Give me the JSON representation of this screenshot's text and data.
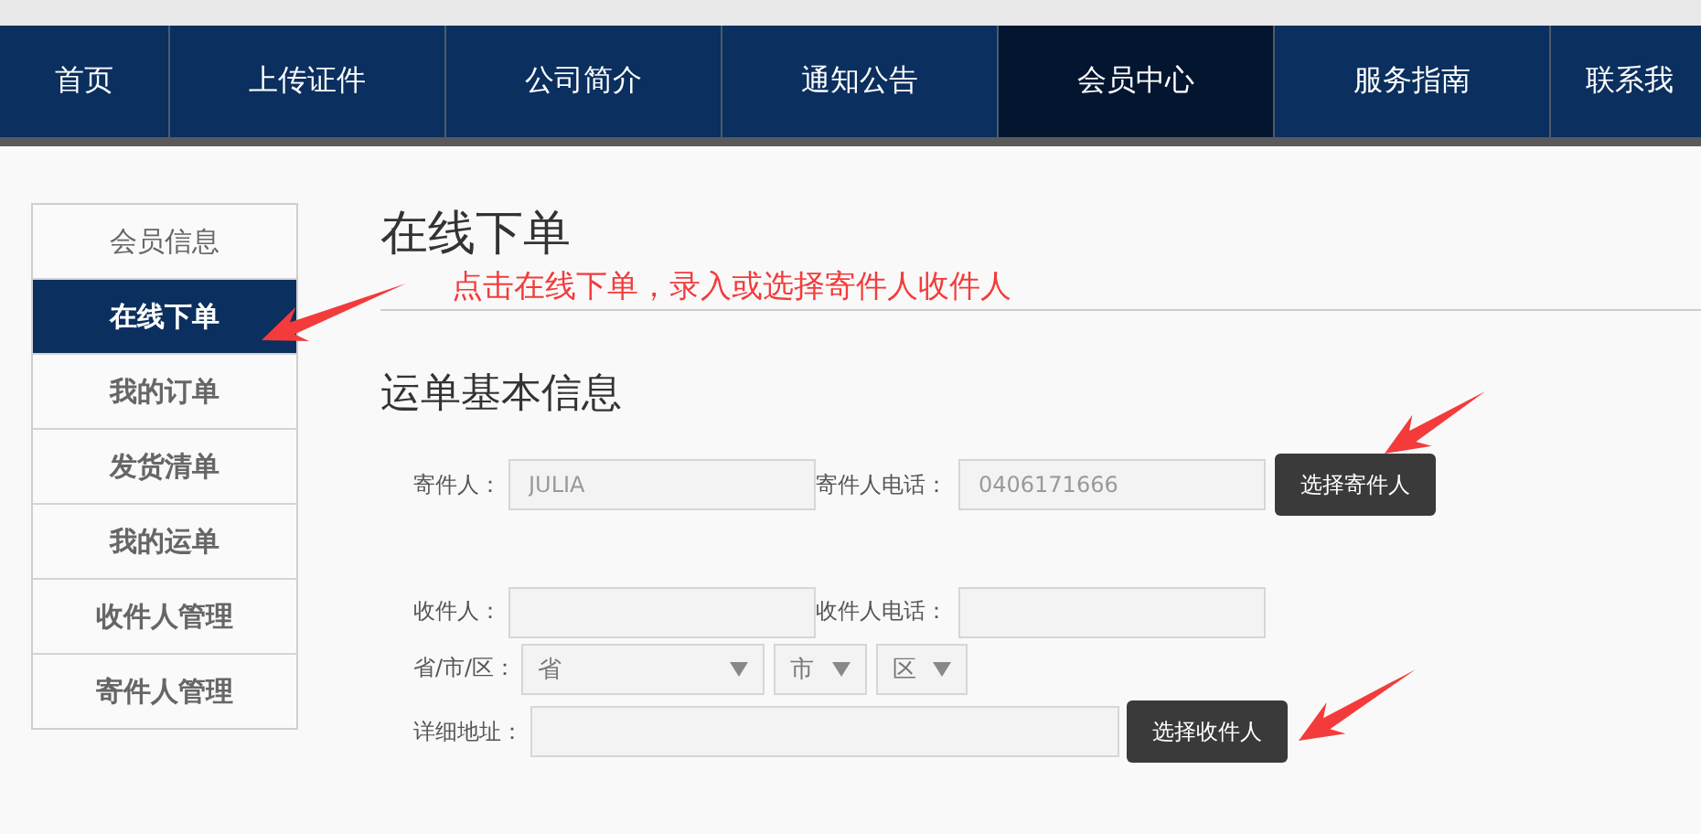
{
  "nav": [
    {
      "label": "首页",
      "selected": false
    },
    {
      "label": "上传证件",
      "selected": false
    },
    {
      "label": "公司简介",
      "selected": false
    },
    {
      "label": "通知公告",
      "selected": false
    },
    {
      "label": "会员中心",
      "selected": true
    },
    {
      "label": "服务指南",
      "selected": false
    },
    {
      "label": "联系我",
      "selected": false
    }
  ],
  "sidebar": {
    "items": [
      {
        "label": "会员信息",
        "selected": false
      },
      {
        "label": "在线下单",
        "selected": true
      },
      {
        "label": "我的订单",
        "selected": false
      },
      {
        "label": "发货清单",
        "selected": false
      },
      {
        "label": "我的运单",
        "selected": false
      },
      {
        "label": "收件人管理",
        "selected": false
      },
      {
        "label": "寄件人管理",
        "selected": false
      }
    ]
  },
  "page_title": "在线下单",
  "annotation": "点击在线下单，录入或选择寄件人收件人",
  "section_title": "运单基本信息",
  "sender": {
    "name_label": "寄件人：",
    "name_value": "JULIA",
    "phone_label": "寄件人电话：",
    "phone_value": "0406171666",
    "readonly": true,
    "button": "选择寄件人"
  },
  "recipient": {
    "name_label": "收件人：",
    "phone_label": "收件人电话：",
    "region_label": "省/市/区：",
    "selects": [
      "省",
      "市",
      "区"
    ],
    "address_label": "详细地址：",
    "button": "选择收件人"
  }
}
